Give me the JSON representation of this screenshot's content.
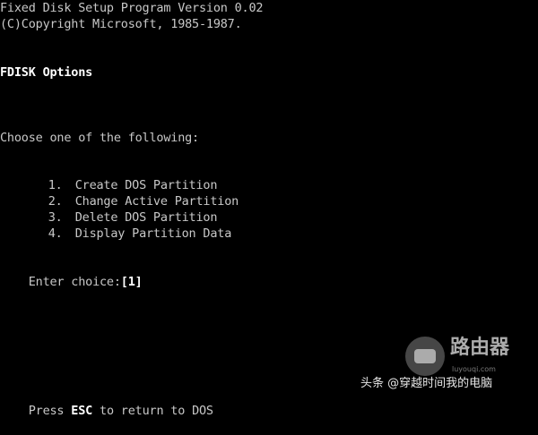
{
  "header": {
    "title_line": "Fixed Disk Setup Program Version 0.02",
    "copyright_line": "(C)Copyright Microsoft, 1985-1987."
  },
  "section": {
    "title": "FDISK Options"
  },
  "prompt": {
    "instruction": "Choose one of the following:"
  },
  "menu": {
    "items": [
      {
        "number": "1.",
        "label": "Create DOS Partition"
      },
      {
        "number": "2.",
        "label": "Change Active Partition"
      },
      {
        "number": "3.",
        "label": "Delete DOS Partition"
      },
      {
        "number": "4.",
        "label": "Display Partition Data"
      }
    ]
  },
  "choice": {
    "label": "Enter choice:",
    "value": "[1]"
  },
  "footer": {
    "press": "Press ",
    "key": "ESC",
    "rest": " to return to DOS"
  },
  "watermark": {
    "brand": "路由器",
    "url": "luyouqi.com",
    "account": "头条 @穿越时间我的电脑"
  },
  "colors": {
    "background": "#000000",
    "text": "#c8c8c8",
    "bright_text": "#ffffff"
  }
}
